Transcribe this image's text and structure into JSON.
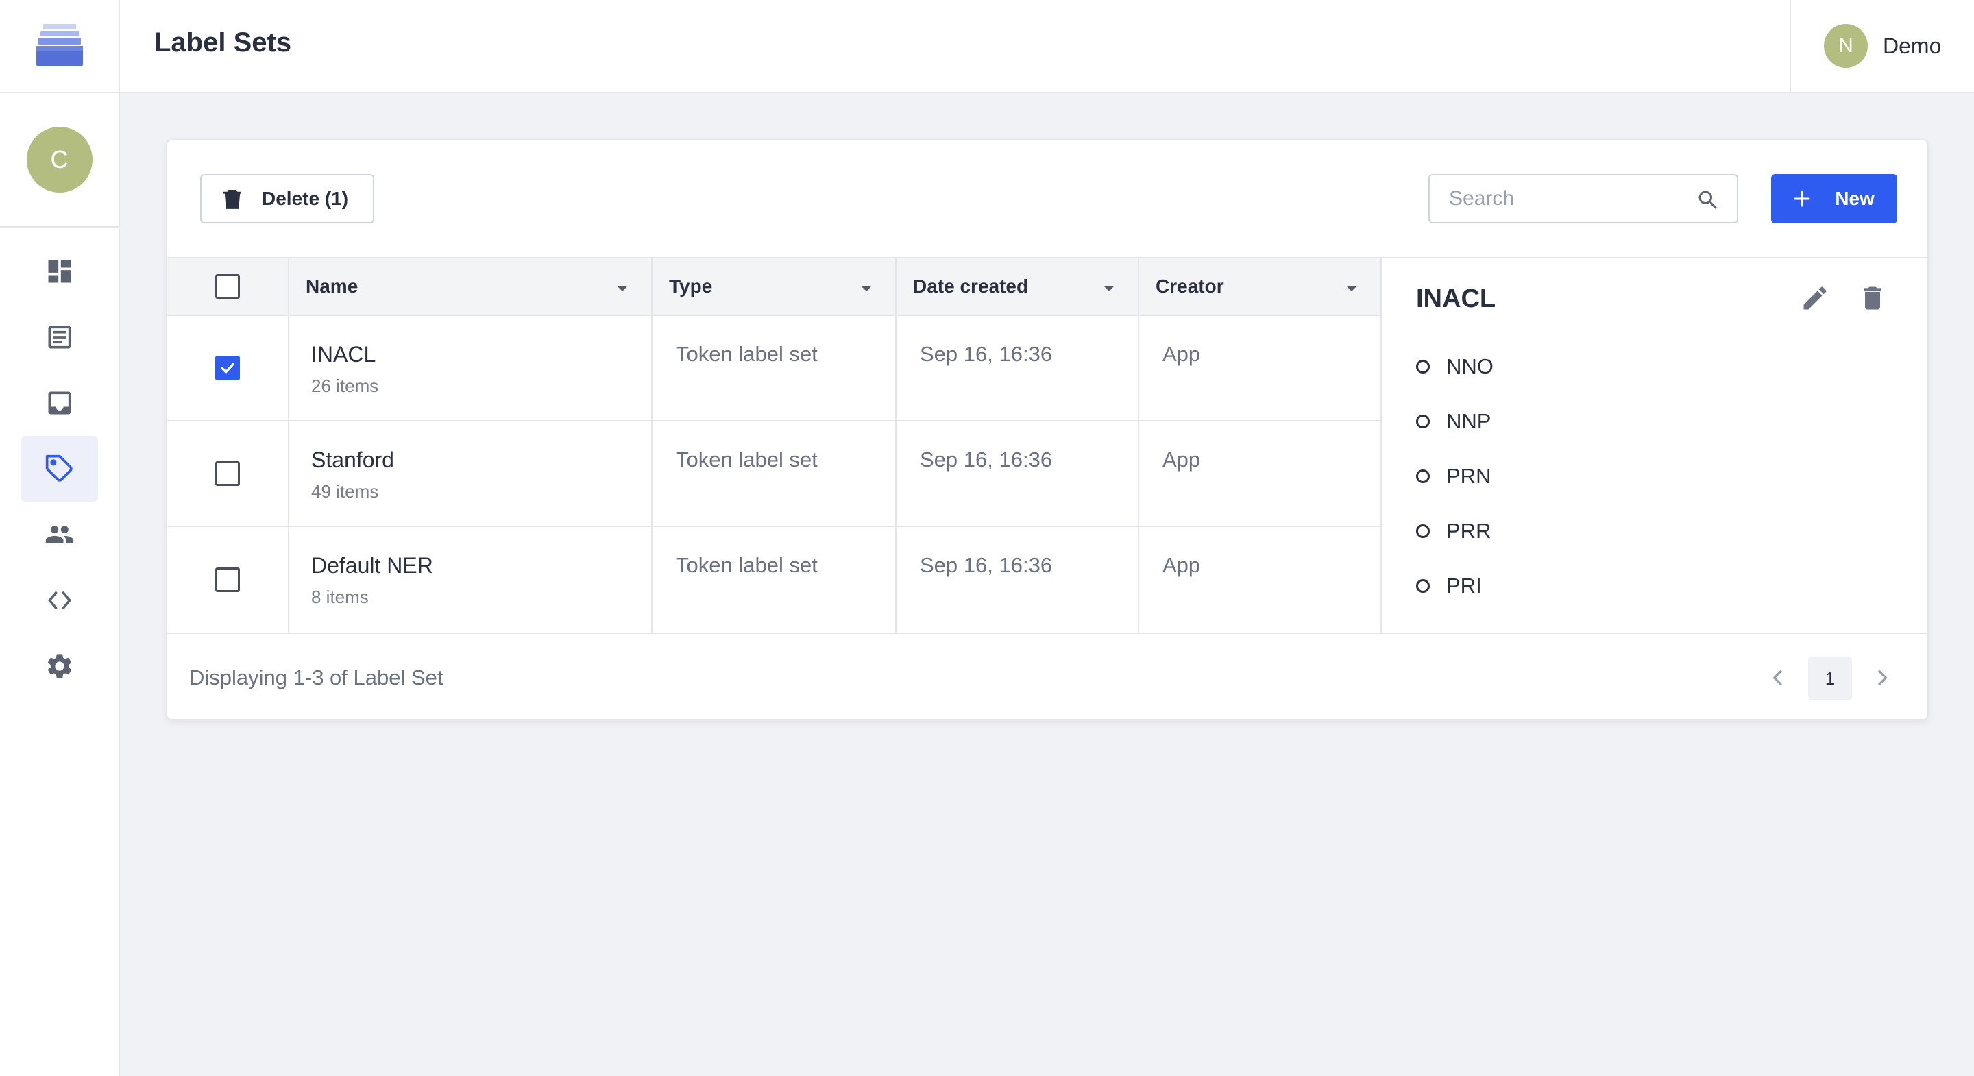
{
  "header": {
    "title": "Label Sets",
    "user": {
      "initial": "N",
      "name": "Demo"
    }
  },
  "sidebar": {
    "user_initial": "C",
    "items": [
      {
        "icon": "dashboard-icon",
        "active": false
      },
      {
        "icon": "document-list-icon",
        "active": false
      },
      {
        "icon": "inbox-icon",
        "active": false
      },
      {
        "icon": "tag-icon",
        "active": true
      },
      {
        "icon": "people-icon",
        "active": false
      },
      {
        "icon": "code-icon",
        "active": false
      },
      {
        "icon": "gear-icon",
        "active": false
      }
    ]
  },
  "toolbar": {
    "delete_label": "Delete (1)",
    "search_placeholder": "Search",
    "new_label": "New"
  },
  "table": {
    "columns": [
      "Name",
      "Type",
      "Date created",
      "Creator"
    ],
    "rows": [
      {
        "name": "INACL",
        "items": "26 items",
        "type": "Token label set",
        "date": "Sep 16, 16:36",
        "creator": "App",
        "checked": true
      },
      {
        "name": "Stanford",
        "items": "49 items",
        "type": "Token label set",
        "date": "Sep 16, 16:36",
        "creator": "App",
        "checked": false
      },
      {
        "name": "Default NER",
        "items": "8 items",
        "type": "Token label set",
        "date": "Sep 16, 16:36",
        "creator": "App",
        "checked": false
      }
    ]
  },
  "detail": {
    "title": "INACL",
    "labels": [
      "NNO",
      "NNP",
      "PRN",
      "PRR",
      "PRI"
    ]
  },
  "footer": {
    "displaying": "Displaying 1-3 of Label Set",
    "current_page": "1"
  },
  "colors": {
    "accent": "#2e5cf0",
    "avatar": "#b3bd80",
    "background": "#f1f2f6"
  }
}
